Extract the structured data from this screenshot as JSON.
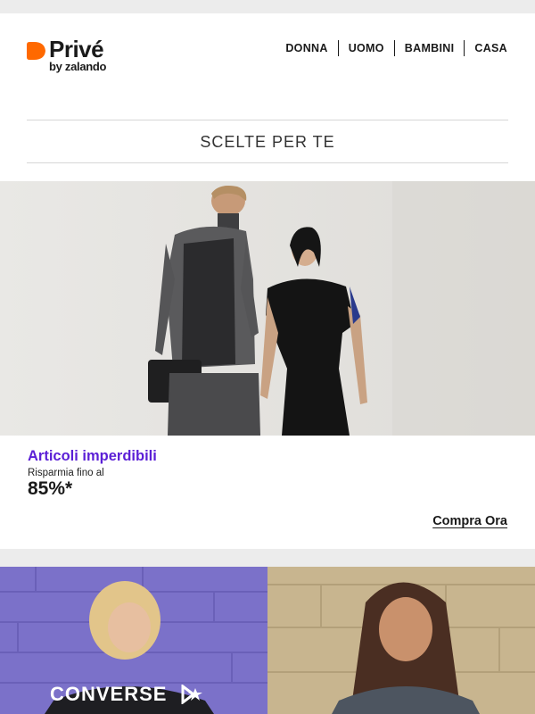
{
  "brand": {
    "name": "Privé",
    "subtitle": "by zalando",
    "accent_color": "#ff6900"
  },
  "nav": {
    "items": [
      {
        "label": "DONNA"
      },
      {
        "label": "UOMO"
      },
      {
        "label": "BAMBINI"
      },
      {
        "label": "CASA"
      }
    ]
  },
  "section": {
    "title": "SCELTE PER TE"
  },
  "hero": {
    "image_alt": "fashion-models-image",
    "title": "Articoli imperdibili",
    "title_color": "#5b1fd6",
    "subtitle": "Risparmia fino al",
    "discount": "85%*",
    "cta": "Compra Ora"
  },
  "tiles": {
    "left": {
      "brand": "CONVERSE",
      "background": "#7b71c9"
    },
    "right": {
      "background": "#c8b58f"
    }
  }
}
